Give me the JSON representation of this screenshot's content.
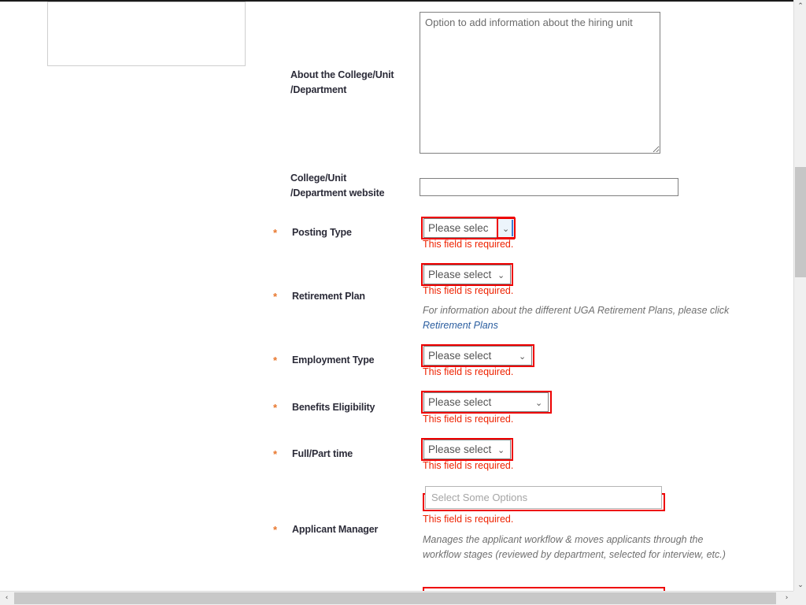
{
  "page": {
    "top_rule": true,
    "placeholder_card": ""
  },
  "fields": {
    "about": {
      "label_line1": "About the College/Unit",
      "label_line2": "/Department",
      "required": false,
      "placeholder": "Option to add information about the hiring unit",
      "value": ""
    },
    "website": {
      "label_line1": "College/Unit",
      "label_line2": "/Department website",
      "required": false,
      "value": "",
      "placeholder": ""
    },
    "posting_type": {
      "label": "Posting Type",
      "required": true,
      "star": "*",
      "selected": "Please select",
      "error": "This field is required.",
      "focused": true
    },
    "retirement_plan": {
      "label": "Retirement Plan",
      "required": true,
      "star": "*",
      "selected": "Please select",
      "error": "This field is required.",
      "hint_before": "For information about the different UGA Retirement Plans, please click ",
      "hint_link": "Retirement Plans"
    },
    "employment_type": {
      "label": "Employment Type",
      "required": true,
      "star": "*",
      "selected": "Please select",
      "error": "This field is required."
    },
    "benefits_eligibility": {
      "label": "Benefits Eligibility",
      "required": true,
      "star": "*",
      "selected": "Please select",
      "error": "This field is required."
    },
    "full_part_time": {
      "label": "Full/Part time",
      "required": true,
      "star": "*",
      "selected": "Please select",
      "error": "This field is required."
    },
    "applicant_manager": {
      "label": "Applicant Manager",
      "required": true,
      "star": "*",
      "placeholder": "Select Some Options",
      "value": "",
      "error": "This field is required.",
      "hint": "Manages the applicant workflow & moves applicants through the workflow stages (reviewed by department, selected for interview, etc.)"
    }
  },
  "icons": {
    "caret_down": "⌄",
    "scroll_up": "⌃",
    "scroll_down": "⌄",
    "scroll_left": "‹",
    "scroll_right": "›"
  },
  "colors": {
    "error_red": "#ee0000",
    "required_star_orange": "#e8762c",
    "label_navy": "#2b2b38",
    "link_blue": "#2a5d9f",
    "hint_gray": "#6f6f6f"
  }
}
